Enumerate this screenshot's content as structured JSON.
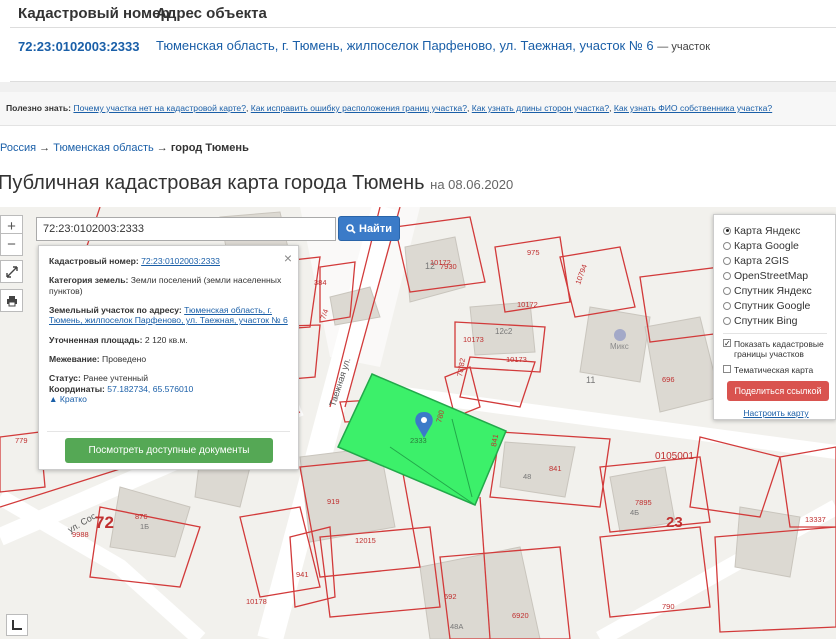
{
  "table": {
    "col_number": "Кадастровый номер",
    "col_address": "Адрес объекта",
    "row": {
      "number": "72:23:0102003:2333",
      "address": "Тюменская область, г. Тюмень, жилпоселок Парфеново, ул. Таежная, участок № 6",
      "kind": "— участок"
    }
  },
  "useful": {
    "label": "Полезно знать:",
    "links": [
      "Почему участка нет на кадастровой карте?",
      "Как исправить ошибку расположения границ участка?",
      "Как узнать длины сторон участка?",
      "Как узнать ФИО собственника участка?"
    ]
  },
  "breadcrumb": {
    "root": "Россия",
    "region": "Тюменская область",
    "current": "город Тюмень",
    "sep": "→"
  },
  "page": {
    "title": "Публичная кадастровая карта города Тюмень",
    "date": "на 08.06.2020"
  },
  "map": {
    "search_value": "72:23:0102003:2333",
    "find_label": "Найти",
    "zoom_in": "+",
    "zoom_out": "−",
    "labels": {
      "taezhnaya": "Таежная ул.",
      "sosnovaya": "ул. Сос",
      "mix": "Микс",
      "n72": "72",
      "n23": "23",
      "block": "0105001"
    },
    "numbers": [
      "10172",
      "7930",
      "975",
      "12",
      "10794",
      "10172",
      "12с2",
      "10173",
      "10173",
      "78/82",
      "11",
      "696",
      "384",
      "7/4",
      "780",
      "2333",
      "841",
      "841",
      "48",
      "7895",
      "4Б",
      "13337",
      "779",
      "876",
      "9988",
      "1Б",
      "919",
      "12015",
      "941",
      "692",
      "10178",
      "6920",
      "48А",
      "790"
    ]
  },
  "info": {
    "cad_label": "Кадастровый номер:",
    "cad_value": "72:23:0102003:2333",
    "cat_label": "Категория земель:",
    "cat_value": "Земли поселений (земли населенных пунктов)",
    "addr_label": "Земельный участок по адресу:",
    "addr_value": "Тюменская область, г. Тюмень, жилпоселок Парфеново, ул. Таежная, участок № 6",
    "area_label": "Уточненная площадь:",
    "area_value": "2 120 кв.м.",
    "survey_label": "Межевание:",
    "survey_value": "Проведено",
    "status_label": "Статус:",
    "status_value": "Ранее учтенный",
    "coord_label": "Координаты:",
    "coord_value": "57.182734, 65.576010",
    "brief": "Кратко",
    "docs_button": "Посмотреть доступные документы",
    "close": "×"
  },
  "layers": {
    "options": [
      "Карта Яндекс",
      "Карта Google",
      "Карта 2GIS",
      "OpenStreetMap",
      "Спутник Яндекс",
      "Спутник Google",
      "Спутник Bing"
    ],
    "selected_index": 0,
    "show_borders": "Показать кадастровые границы участков",
    "show_borders_checked": true,
    "thematic": "Тематическая карта",
    "thematic_checked": false,
    "share": "Поделиться ссылкой",
    "setup": "Настроить карту"
  },
  "colors": {
    "link": "#1a5fa8",
    "parcel_fill": "#3cf06a",
    "cad_border": "#d23a3a",
    "find_button": "#3b7bc8",
    "docs_button": "#55a855",
    "share_button": "#d9534f"
  }
}
